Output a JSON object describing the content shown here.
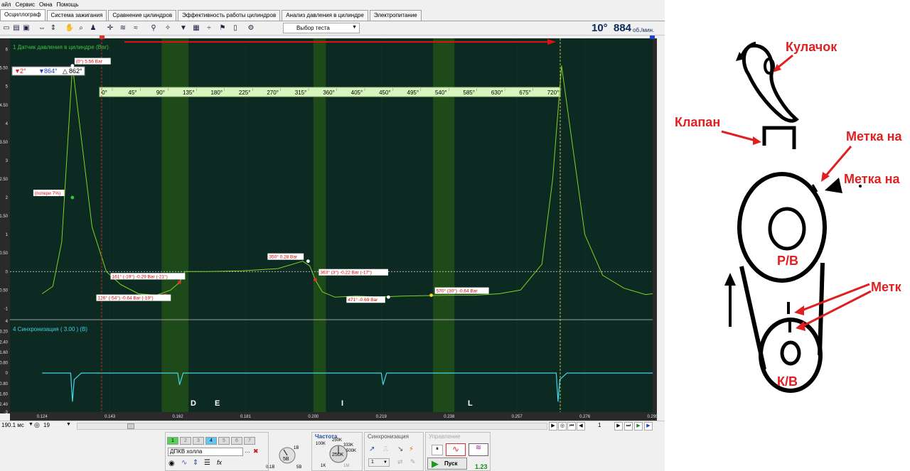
{
  "menu": [
    "айл",
    "Сервис",
    "Окна",
    "Помощь"
  ],
  "tabs": [
    "Осциллограф",
    "Система зажигания",
    "Сравнение цилиндров",
    "Эффективность работы цилиндров",
    "Анализ давления в цилиндре",
    "Электропитание"
  ],
  "toolbar": {
    "test_select": "Выбор теста",
    "angle": "10°",
    "rpm": "884",
    "rpm_unit": "об./мин."
  },
  "markers": {
    "cursor1": "2°",
    "cursor2": "864°",
    "delta": "862°"
  },
  "channel1": {
    "title": "1 Датчик давления в цилиндре (Bar)"
  },
  "channel4": {
    "title": "4 Синхронизация ( 3.00 ) (B)"
  },
  "ch1_yticks": [
    "6",
    "5.50",
    "5",
    "4.50",
    "4",
    "3.50",
    "3",
    "2.50",
    "2",
    "1.50",
    "1",
    "0.50",
    "0",
    "-0.50",
    "-1"
  ],
  "ch4_yticks": [
    "4",
    "3.20",
    "2.40",
    "1.60",
    "0.80",
    "0",
    "-0.80",
    "-1.60",
    "-2.40",
    "-3"
  ],
  "x_ticks": [
    "0.124",
    "0.143",
    "0.162",
    "0.181",
    "0.200",
    "0.219",
    "0.238",
    "0.257",
    "0.276",
    "0.295"
  ],
  "angle_scale": [
    "0°",
    "45°",
    "90°",
    "135°",
    "180°",
    "225°",
    "270°",
    "315°",
    "360°",
    "405°",
    "450°",
    "495°",
    "540°",
    "585°",
    "630°",
    "675°",
    "720°"
  ],
  "annotations": [
    "(0°) 5.56 Bar",
    "(потери 7%)",
    "161° (-19°) -0.29 Bar (-21°)",
    "126° (-54°) -0.64 Bar (-19°)",
    "350° 0.28 Bar",
    "363° (3°) -0.22 Bar (-17°)",
    "471° -0.69 Bar",
    "570° (30°) -0.64 Bar"
  ],
  "zones": [
    "D",
    "E",
    "I",
    "L"
  ],
  "nav": {
    "timebase": "190.1 мс",
    "channel": "19",
    "page": "1"
  },
  "bottom": {
    "channels": [
      "1",
      "2",
      "3",
      "4",
      "5",
      "6",
      "7"
    ],
    "sensor": "ДПКВ холла",
    "freq_title": "Частота",
    "freq_dial": "250K",
    "freq_labels": [
      "100K",
      "250K",
      "333K",
      "500K",
      "1K",
      "1M"
    ],
    "range_labels": [
      "1B",
      "5B",
      "0.1B",
      "5B"
    ],
    "sync_title": "Синхронизация",
    "sync_value": "1",
    "control_title": "Управление",
    "play": "Пуск",
    "version": "1.23"
  },
  "diagram": {
    "cam": "Кулачок",
    "valve": "Клапан",
    "mark1": "Метка на",
    "mark2": "Метка на",
    "mark3": "Метк",
    "rv": "Р/В",
    "kv": "К/В"
  },
  "colors": {
    "scope_bg": "#0d2a22",
    "trace_pressure": "#7ed321",
    "trace_sync": "#40d8e8",
    "cursor": "#e03030",
    "zone": "#1e4a1a",
    "diagram_text": "#e02020"
  },
  "chart_data": {
    "type": "line",
    "series": [
      {
        "name": "1 Датчик давления в цилиндре (Bar)",
        "x": [
          0.124,
          0.127,
          0.1295,
          0.131,
          0.1325,
          0.135,
          0.138,
          0.142,
          0.146,
          0.151,
          0.156,
          0.16,
          0.1625,
          0.164,
          0.17,
          0.18,
          0.19,
          0.197,
          0.199,
          0.2005,
          0.2025,
          0.206,
          0.212,
          0.218,
          0.225,
          0.232,
          0.238,
          0.245,
          0.252,
          0.258,
          0.264,
          0.267,
          0.2695,
          0.272,
          0.276,
          0.281,
          0.287,
          0.293,
          0.295
        ],
        "y": [
          -0.6,
          -0.4,
          0.8,
          3.2,
          5.56,
          3.6,
          1.2,
          0.0,
          -0.35,
          -0.6,
          -0.64,
          -0.5,
          -0.29,
          0.0,
          0.0,
          0.02,
          0.08,
          0.28,
          0.15,
          -0.22,
          -0.55,
          -0.69,
          -0.66,
          -0.69,
          -0.66,
          -0.65,
          -0.64,
          -0.64,
          -0.6,
          -0.5,
          0.2,
          2.5,
          5.56,
          3.8,
          1.0,
          -0.1,
          -0.45,
          -0.62,
          -0.6
        ]
      },
      {
        "name": "4 Синхронизация ( 3.00 ) (B)",
        "x": [
          0.124,
          0.132,
          0.1325,
          0.133,
          0.135,
          0.162,
          0.1625,
          0.1635,
          0.219,
          0.2195,
          0.2205,
          0.268,
          0.2685,
          0.269,
          0.271,
          0.295
        ],
        "y": [
          0.0,
          0.0,
          -2.2,
          -0.5,
          0.0,
          0.0,
          -0.9,
          0.0,
          0.0,
          -0.9,
          0.0,
          0.0,
          -2.2,
          -0.5,
          0.0,
          0.0
        ]
      }
    ],
    "xlim": [
      0.115,
      0.295
    ],
    "ylim_ch1": [
      -1.3,
      6.3
    ],
    "ylim_ch4": [
      -3,
      4
    ],
    "grid": true
  }
}
